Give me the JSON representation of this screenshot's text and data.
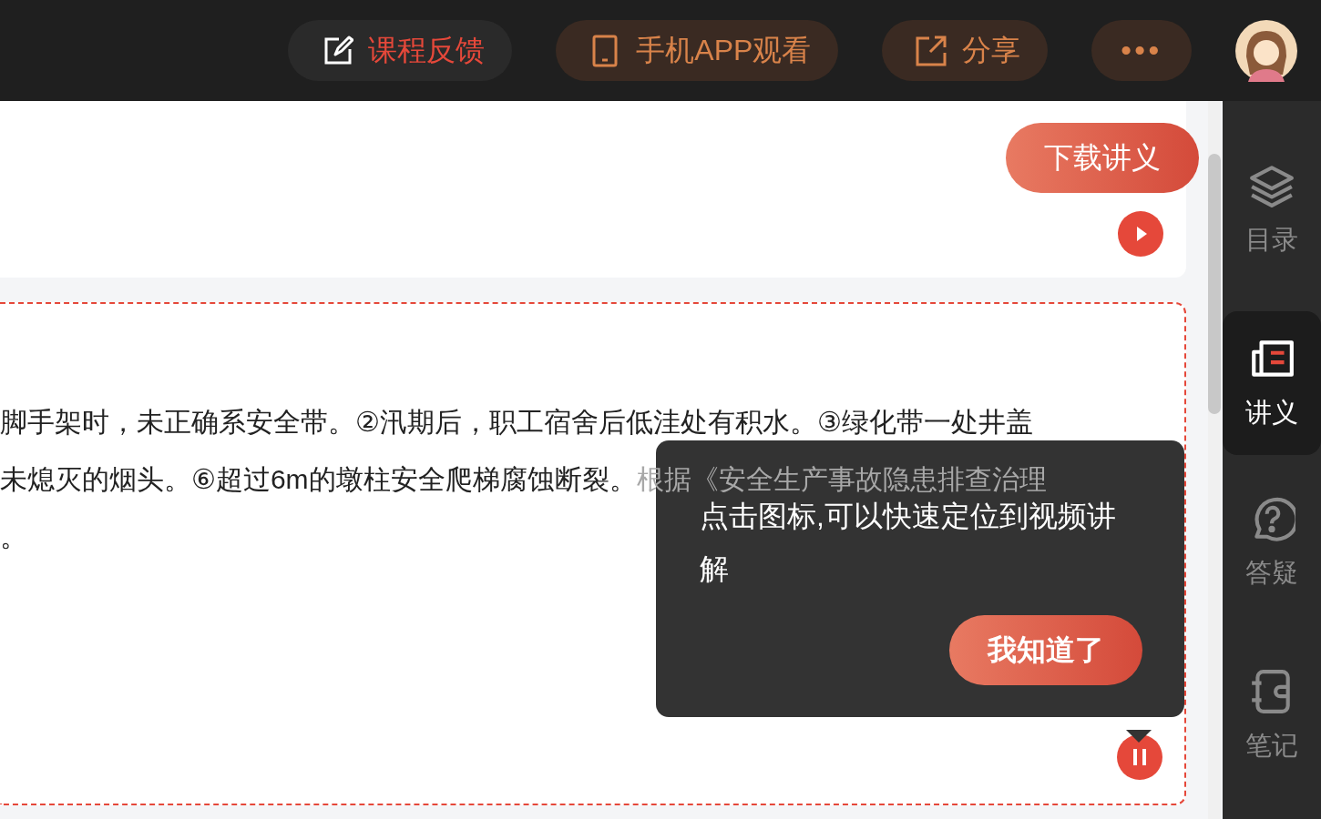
{
  "top_bar": {
    "buttons": [
      {
        "label": "课程反馈",
        "kind": "feedback"
      },
      {
        "label": "手机APP观看",
        "kind": "mobile"
      },
      {
        "label": "分享",
        "kind": "share"
      },
      {
        "label": "•••",
        "kind": "more"
      }
    ]
  },
  "handout": {
    "download_button": "下载讲义"
  },
  "content": {
    "lines": [
      "脚手架时，未正确系安全带。②汛期后，职工宿舍后低洼处有积水。③绿化带一处井盖",
      "未熄灭的烟头。⑥超过6m的墩柱安全爬梯腐蚀断裂。根据《安全生产事故隐患排查治理",
      "。"
    ]
  },
  "tooltip": {
    "text": "点击图标,可以快速定位到视频讲解",
    "button": "我知道了"
  },
  "sidebar": {
    "items": [
      {
        "label": "目录",
        "kind": "catalog",
        "selected": false
      },
      {
        "label": "讲义",
        "kind": "handout",
        "selected": true
      },
      {
        "label": "答疑",
        "kind": "qa",
        "selected": false
      },
      {
        "label": "笔记",
        "kind": "notes",
        "selected": false
      }
    ]
  }
}
